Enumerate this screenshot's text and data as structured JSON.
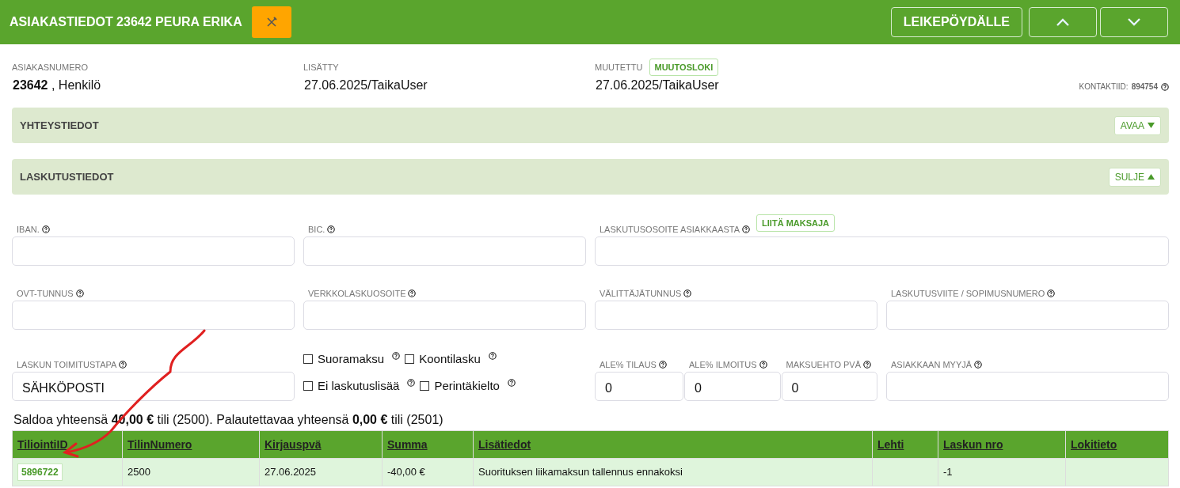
{
  "header": {
    "title": "ASIAKASTIEDOT 23642 PEURA ERIKA",
    "buttons": [
      {
        "kind": "text",
        "label": "LEIKEPÖYDÄLLE"
      },
      {
        "kind": "up"
      },
      {
        "kind": "down"
      }
    ]
  },
  "summary": {
    "customer": {
      "label": "ASIAKASNUMERO",
      "value": "**23642** , Henkilö"
    },
    "added": {
      "label": "LISÄTTY",
      "value": "27.06.2025/TaikaUser"
    },
    "modified": {
      "label": "MUUTETTU",
      "button": "MUUTOSLOKI",
      "value": "27.06.2025/TaikaUser"
    },
    "contact_id": {
      "label": "KONTAKTIID:",
      "value": "894754"
    }
  },
  "sections": [
    {
      "title": "YHTEYSTIEDOT",
      "toggle": "AVAA",
      "expanded": false
    },
    {
      "title": "LASKUTUSTIEDOT",
      "toggle": "SULJE",
      "expanded": true
    }
  ],
  "field_rows": [
    [
      {
        "kind": "field",
        "label": "IBAN."
      },
      {
        "kind": "field",
        "label": "BIC."
      },
      {
        "kind": "wide_field",
        "label": "LASKUTUSOSOITE ASIAKKAASTA",
        "button": "LIITÄ MAKSAJA"
      }
    ],
    [
      {
        "kind": "field",
        "label": "OVT-TUNNUS"
      },
      {
        "kind": "field",
        "label": "VERKKOLASKUOSOITE"
      },
      {
        "kind": "field",
        "label": "VÄLITTÄJÄTUNNUS"
      },
      {
        "kind": "field",
        "label": "LASKUTUSVIITE / SOPIMUSNUMERO"
      }
    ],
    [
      {
        "kind": "field",
        "label": "LASKUN TOIMITUSTAPA",
        "value": "SÄHKÖPOSTI"
      },
      {
        "kind": "checks",
        "lines": [
          [
            {
              "label": "Suoramaksu",
              "checked": false
            },
            {
              "label": "Koontilasku",
              "checked": false
            }
          ],
          [
            {
              "label": "Ei laskutuslisää",
              "checked": false
            },
            {
              "label": "Perintäkielto",
              "checked": false
            }
          ]
        ]
      },
      {
        "kind": "trio",
        "fields": [
          {
            "label": "ALE% TILAUS",
            "value": "0"
          },
          {
            "label": "ALE% ILMOITUS",
            "value": "0"
          },
          {
            "label": "MAKSUEHTO PVÄ",
            "value": "0"
          }
        ]
      },
      {
        "kind": "field",
        "label": "ASIAKKAAN MYYJÄ"
      }
    ]
  ],
  "balance": "Saldoa yhteensä **40,00 €** tili (2500). Palautettavaa yhteensä **0,00 €** tili (2501)",
  "table": {
    "columns": [
      "TiliointiID",
      "TilinNumero",
      "Kirjauspvä",
      "Summa",
      "Lisätiedot",
      "Lehti",
      "Laskun nro",
      "Lokitieto"
    ],
    "rows": [
      [
        "5896722",
        "2500",
        "27.06.2025",
        "-40,00 €",
        "Suorituksen liikamaksun tallennus ennakoksi",
        "",
        "-1",
        ""
      ]
    ]
  },
  "annotation": {
    "kind": "arrow"
  }
}
